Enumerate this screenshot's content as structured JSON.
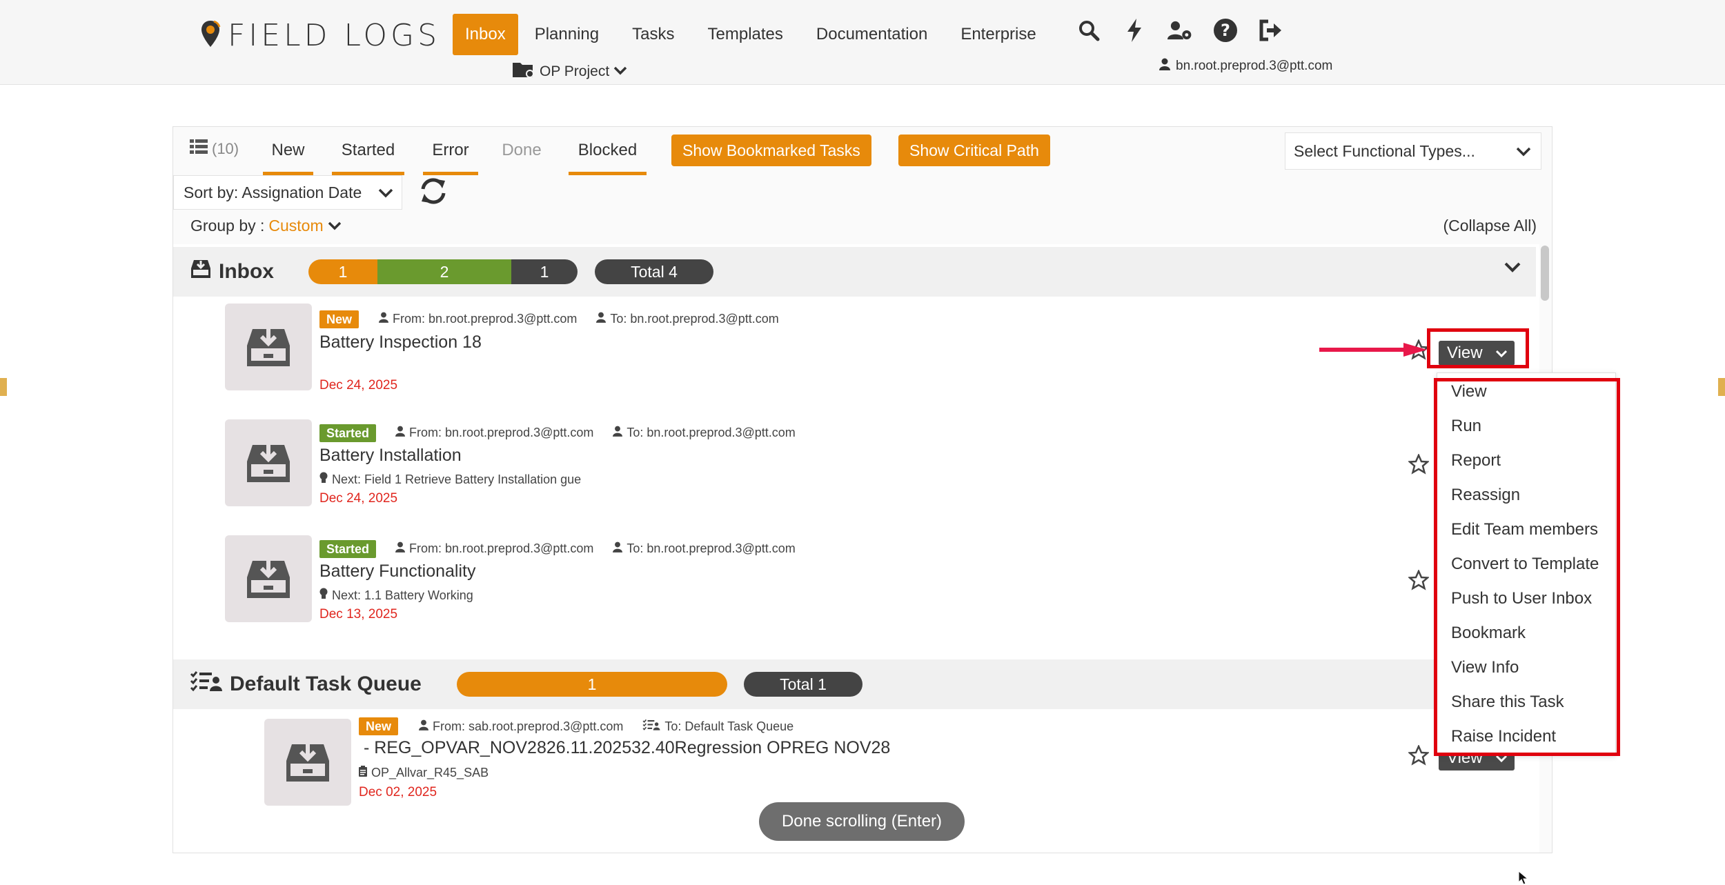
{
  "app": {
    "logo_text": "FIELD LOGS",
    "nav": [
      "Inbox",
      "Planning",
      "Tasks",
      "Templates",
      "Documentation",
      "Enterprise"
    ],
    "project": "OP Project",
    "user": "bn.root.preprod.3@ptt.com",
    "accent_color": "#e78a0b",
    "nav_icons": [
      "search-icon",
      "bolt-icon",
      "user-settings-icon",
      "help-icon",
      "logout-icon"
    ]
  },
  "filters": {
    "list_count": "(10)",
    "tabs": [
      "New",
      "Started",
      "Error",
      "Done",
      "Blocked"
    ],
    "bookmarked_button": "Show Bookmarked Tasks",
    "critical_path_button": "Show Critical Path",
    "functional_types_placeholder": "Select Functional Types...",
    "sort_label": "Sort by: Assignation Date",
    "group_by_label": "Group by :",
    "group_by_value": "Custom",
    "collapse_all": "(Collapse All)"
  },
  "groups": [
    {
      "title": "Inbox",
      "segments": [
        {
          "value": "1",
          "color": "#e78a0b"
        },
        {
          "value": "2",
          "color": "#6a9a2e"
        },
        {
          "value": "1",
          "color": "#444444"
        }
      ],
      "total": "Total 4"
    },
    {
      "title": "Default Task Queue",
      "segments": [
        {
          "value": "1",
          "color": "#e78a0b"
        }
      ],
      "total": "Total 1"
    }
  ],
  "tasks": [
    {
      "status": "New",
      "from": "From: bn.root.preprod.3@ptt.com",
      "to": "To: bn.root.preprod.3@ptt.com",
      "name": "Battery Inspection 18",
      "next": "",
      "date": "Dec 24, 2025",
      "view_label": "View"
    },
    {
      "status": "Started",
      "from": "From: bn.root.preprod.3@ptt.com",
      "to": "To: bn.root.preprod.3@ptt.com",
      "name": "Battery Installation",
      "next": "Next: Field 1 Retrieve Battery Installation gue",
      "date": "Dec 24, 2025",
      "view_label": "View"
    },
    {
      "status": "Started",
      "from": "From: bn.root.preprod.3@ptt.com",
      "to": "To: bn.root.preprod.3@ptt.com",
      "name": "Battery Functionality",
      "next": "Next: 1.1 Battery Working",
      "date": "Dec 13, 2025",
      "view_label": "View"
    },
    {
      "status": "New",
      "from": "From: sab.root.preprod.3@ptt.com",
      "to": "To: Default Task Queue",
      "name": " - REG_OPVAR_NOV2826.11.202532.40Regression OPREG NOV28",
      "template": "OP_Allvar_R45_SAB",
      "date": "Dec 02, 2025",
      "view_label": "View"
    }
  ],
  "menu": [
    "View",
    "Run",
    "Report",
    "Reassign",
    "Edit Team members",
    "Convert to Template",
    "Push to User Inbox",
    "Bookmark",
    "View Info",
    "Share this Task",
    "Raise Incident"
  ],
  "toast": "Done scrolling (Enter)"
}
